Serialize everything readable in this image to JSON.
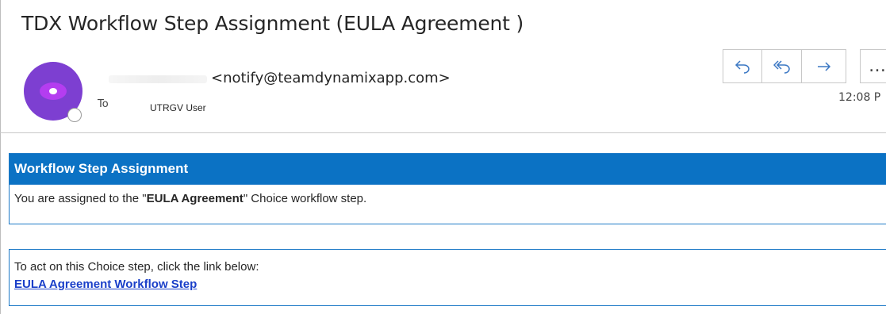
{
  "message": {
    "subject": "TDX Workflow Step Assignment (EULA Agreement )",
    "sender_email": "<notify@teamdynamixapp.com>",
    "to_label": "To",
    "to_value": "UTRGV User",
    "time": "12:08 P"
  },
  "actions": {
    "reply_icon": "reply-icon",
    "reply_all_icon": "reply-all-icon",
    "forward_icon": "forward-icon",
    "more_label": "…"
  },
  "body": {
    "header": "Workflow Step Assignment",
    "assigned_prefix": "You are assigned to the \"",
    "assigned_step": "EULA Agreement ",
    "assigned_suffix": "\" Choice workflow step.",
    "instruction": "To act on this Choice step, click the link below:",
    "link_text": "EULA Agreement Workflow Step"
  },
  "colors": {
    "accent": "#0b72c4",
    "link": "#1a3fc9",
    "avatar": "#7d3fd1"
  }
}
